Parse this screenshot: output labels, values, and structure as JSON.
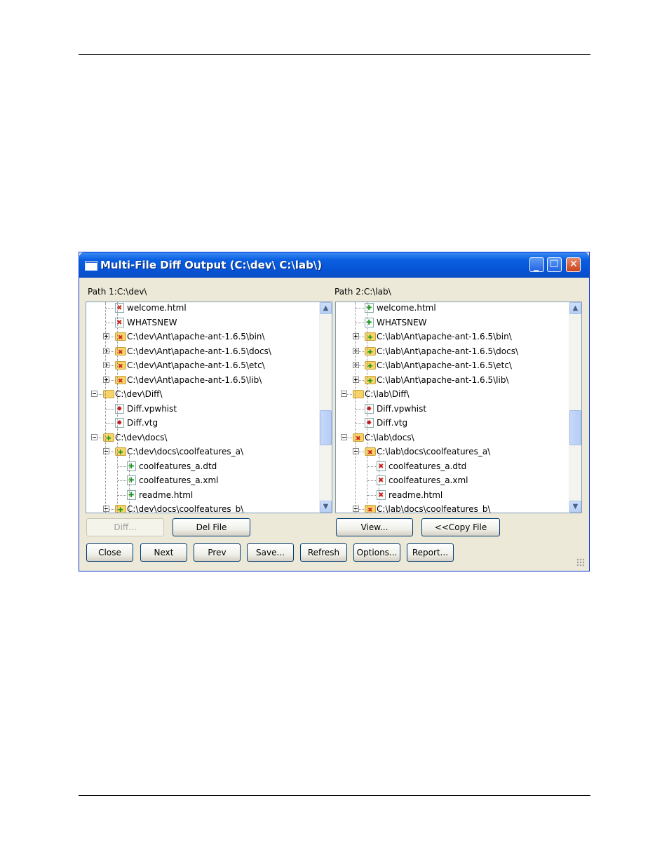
{
  "window": {
    "title": "Multi-File Diff Output (C:\\dev\\ C:\\lab\\)"
  },
  "left_pane": {
    "path_label": "Path 1:C:\\dev\\",
    "rows": [
      {
        "label": "welcome.html",
        "icon": "file-deleted-icon"
      },
      {
        "label": "WHATSNEW",
        "icon": "file-deleted-icon"
      },
      {
        "label": "C:\\dev\\Ant\\apache-ant-1.6.5\\bin\\",
        "icon": "folder-deleted-icon"
      },
      {
        "label": "C:\\dev\\Ant\\apache-ant-1.6.5\\docs\\",
        "icon": "folder-deleted-icon"
      },
      {
        "label": "C:\\dev\\Ant\\apache-ant-1.6.5\\etc\\",
        "icon": "folder-deleted-icon"
      },
      {
        "label": "C:\\dev\\Ant\\apache-ant-1.6.5\\lib\\",
        "icon": "folder-deleted-icon"
      },
      {
        "label": "C:\\dev\\Diff\\",
        "icon": "folder-icon"
      },
      {
        "label": "Diff.vpwhist",
        "icon": "file-changed-icon"
      },
      {
        "label": "Diff.vtg",
        "icon": "file-changed-icon"
      },
      {
        "label": "C:\\dev\\docs\\",
        "icon": "folder-added-icon"
      },
      {
        "label": "C:\\dev\\docs\\coolfeatures_a\\",
        "icon": "folder-added-icon"
      },
      {
        "label": "coolfeatures_a.dtd",
        "icon": "file-added-icon"
      },
      {
        "label": "coolfeatures_a.xml",
        "icon": "file-added-icon"
      },
      {
        "label": "readme.html",
        "icon": "file-added-icon"
      },
      {
        "label": "C:\\dev\\docs\\coolfeatures_b\\",
        "icon": "folder-added-icon"
      }
    ]
  },
  "right_pane": {
    "path_label": "Path 2:C:\\lab\\",
    "rows": [
      {
        "label": "welcome.html",
        "icon": "file-added-icon"
      },
      {
        "label": "WHATSNEW",
        "icon": "file-added-icon"
      },
      {
        "label": "C:\\lab\\Ant\\apache-ant-1.6.5\\bin\\",
        "icon": "folder-added-icon"
      },
      {
        "label": "C:\\lab\\Ant\\apache-ant-1.6.5\\docs\\",
        "icon": "folder-added-icon"
      },
      {
        "label": "C:\\lab\\Ant\\apache-ant-1.6.5\\etc\\",
        "icon": "folder-added-icon"
      },
      {
        "label": "C:\\lab\\Ant\\apache-ant-1.6.5\\lib\\",
        "icon": "folder-added-icon"
      },
      {
        "label": "C:\\lab\\Diff\\",
        "icon": "folder-icon"
      },
      {
        "label": "Diff.vpwhist",
        "icon": "file-changed-icon"
      },
      {
        "label": "Diff.vtg",
        "icon": "file-changed-icon"
      },
      {
        "label": "C:\\lab\\docs\\",
        "icon": "folder-deleted-icon"
      },
      {
        "label": "C:\\lab\\docs\\coolfeatures_a\\",
        "icon": "folder-deleted-icon"
      },
      {
        "label": "coolfeatures_a.dtd",
        "icon": "file-deleted-icon"
      },
      {
        "label": "coolfeatures_a.xml",
        "icon": "file-deleted-icon"
      },
      {
        "label": "readme.html",
        "icon": "file-deleted-icon"
      },
      {
        "label": "C:\\lab\\docs\\coolfeatures_b\\",
        "icon": "folder-deleted-icon"
      }
    ]
  },
  "buttons": {
    "diff": "Diff...",
    "del_file": "Del File",
    "view": "View...",
    "copy_file": "<<Copy File",
    "close": "Close",
    "next": "Next",
    "prev": "Prev",
    "save": "Save...",
    "refresh": "Refresh",
    "options": "Options...",
    "report": "Report..."
  },
  "colors": {
    "title_bar": "#0a5fe0",
    "window_face": "#ece9d8",
    "deleted": "#d0201a",
    "added": "#1a9a1a"
  }
}
